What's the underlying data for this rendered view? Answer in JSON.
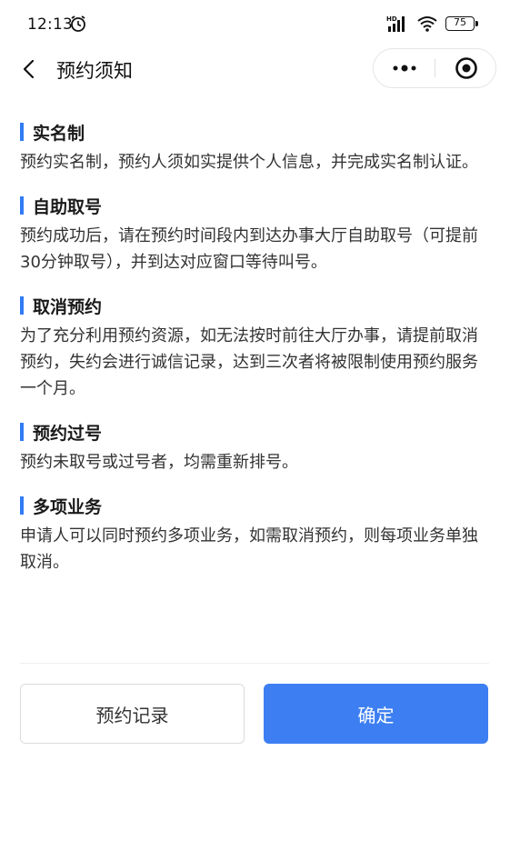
{
  "status_bar": {
    "time": "12:13",
    "battery": "75",
    "network_badge": "HD"
  },
  "nav": {
    "title": "预约须知"
  },
  "sections": [
    {
      "title": "实名制",
      "text": "预约实名制，预约人须如实提供个人信息，并完成实名制认证。"
    },
    {
      "title": "自助取号",
      "text": "预约成功后，请在预约时间段内到达办事大厅自助取号（可提前30分钟取号），并到达对应窗口等待叫号。"
    },
    {
      "title": "取消预约",
      "text": "为了充分利用预约资源，如无法按时前往大厅办事，请提前取消预约，失约会进行诚信记录，达到三次者将被限制使用预约服务一个月。"
    },
    {
      "title": "预约过号",
      "text": "预约未取号或过号者，均需重新排号。"
    },
    {
      "title": "多项业务",
      "text": "申请人可以同时预约多项业务，如需取消预约，则每项业务单独取消。"
    }
  ],
  "buttons": {
    "record_label": "预约记录",
    "confirm_label": "确定"
  },
  "colors": {
    "accent": "#2f7cf6",
    "confirm_bg": "#3d7ff2"
  },
  "icons": {
    "alarm": "alarm-clock-icon",
    "signal": "signal-icon",
    "wifi": "wifi-icon",
    "back": "chevron-left-icon",
    "more": "more-dots-icon",
    "close": "close-circle-icon"
  }
}
